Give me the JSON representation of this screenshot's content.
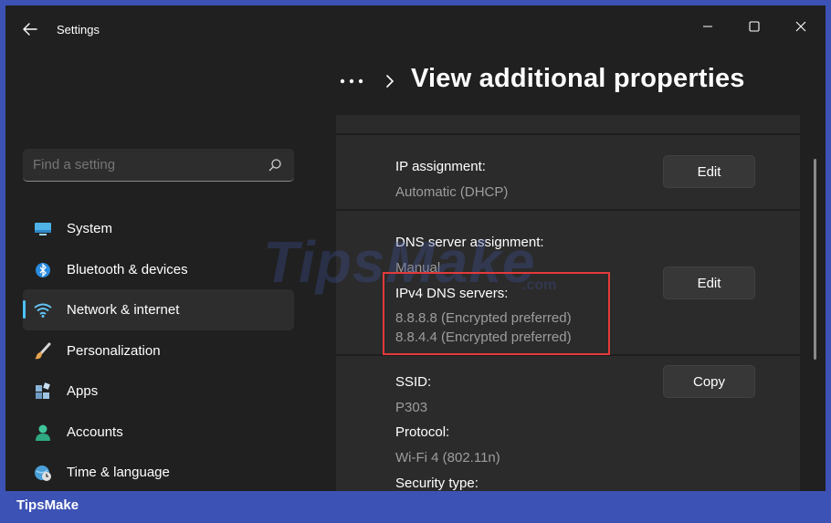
{
  "window": {
    "title": "Settings"
  },
  "search": {
    "placeholder": "Find a setting"
  },
  "sidebar": {
    "items": [
      {
        "label": "System",
        "icon": "monitor-icon"
      },
      {
        "label": "Bluetooth & devices",
        "icon": "bluetooth-icon"
      },
      {
        "label": "Network & internet",
        "icon": "wifi-icon",
        "active": true
      },
      {
        "label": "Personalization",
        "icon": "brush-icon"
      },
      {
        "label": "Apps",
        "icon": "apps-icon"
      },
      {
        "label": "Accounts",
        "icon": "person-icon"
      },
      {
        "label": "Time & language",
        "icon": "globe-clock-icon"
      }
    ]
  },
  "header": {
    "title": "View additional properties"
  },
  "properties": {
    "ip_assignment": {
      "label": "IP assignment:",
      "value": "Automatic (DHCP)",
      "button": "Edit"
    },
    "dns": {
      "label": "DNS server assignment:",
      "value": "Manual",
      "ipv4_label": "IPv4 DNS servers:",
      "servers": [
        "8.8.8.8 (Encrypted preferred)",
        "8.8.4.4 (Encrypted preferred)"
      ],
      "button": "Edit"
    },
    "wifi": {
      "ssid_label": "SSID:",
      "ssid_value": "P303",
      "protocol_label": "Protocol:",
      "protocol_value": "Wi-Fi 4 (802.11n)",
      "security_label": "Security type:",
      "button": "Copy"
    }
  },
  "watermark": {
    "text": "TipsMake",
    "suffix": ".com"
  },
  "brand": {
    "text": "TipsMake"
  },
  "colors": {
    "accent": "#4cc2ff",
    "highlight": "#e33a3a",
    "frame": "#3d52b5"
  }
}
